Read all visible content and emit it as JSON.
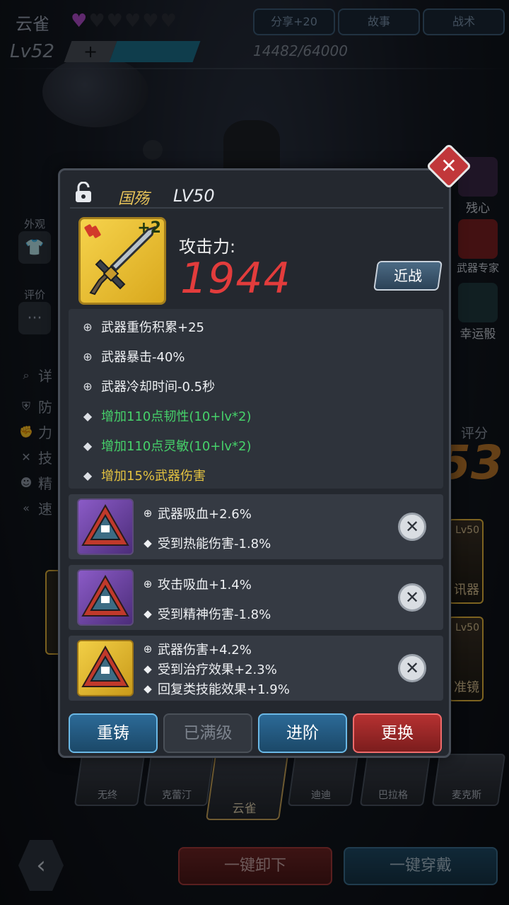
{
  "header": {
    "hero_name": "云雀",
    "hearts_total": 6,
    "hearts_filled": 1,
    "level": "Lv52",
    "exp_plus": "+",
    "exp_text": "14482/64000",
    "exp_progress": 0.23,
    "buttons": {
      "share": "分享+20",
      "story": "故事",
      "tactics": "战术"
    }
  },
  "side_left": {
    "appearance": "外观",
    "rating": "评价",
    "details": "详",
    "stats": [
      "防",
      "力",
      "技",
      "精",
      "速"
    ]
  },
  "side_right": {
    "residual": "残心",
    "weapon_expert": "武器专家",
    "lucky": "幸运骰",
    "score_label": "评分",
    "score_value": "53",
    "card1_level": "Lv50",
    "card1_name": "讯器",
    "card2_level": "Lv50",
    "card2_name": "准镜"
  },
  "heroes": [
    "无终",
    "克蕾汀",
    "云雀",
    "迪迪",
    "巴拉格",
    "麦克斯"
  ],
  "bottom": {
    "unequip_all": "一键卸下",
    "equip_all": "一键穿戴"
  },
  "dialog": {
    "weapon_name": "国殇",
    "weapon_level": "LV50",
    "weapon_plus": "+2",
    "attack_label": "攻击力:",
    "attack_value": "1944",
    "melee": "近战",
    "stats": [
      {
        "text": "武器重伤积累+25",
        "type": "white"
      },
      {
        "text": "武器暴击-40%",
        "type": "white"
      },
      {
        "text": "武器冷却时间-0.5秒",
        "type": "white"
      },
      {
        "text": "增加110点韧性(10+lv*2)",
        "type": "green"
      },
      {
        "text": "增加110点灵敏(10+lv*2)",
        "type": "green"
      },
      {
        "text": "增加15%武器伤害",
        "type": "yellow"
      }
    ],
    "gems": [
      {
        "lines": [
          "武器吸血+2.6%",
          "受到热能伤害-1.8%"
        ],
        "rarity": "purple"
      },
      {
        "lines": [
          "攻击吸血+1.4%",
          "受到精神伤害-1.8%"
        ],
        "rarity": "purple"
      },
      {
        "lines": [
          "武器伤害+4.2%",
          "受到治疗效果+2.3%",
          "回复类技能效果+1.9%"
        ],
        "rarity": "gold"
      }
    ],
    "actions": {
      "reforge": "重铸",
      "maxed": "已满级",
      "advance": "进阶",
      "replace": "更换"
    }
  },
  "colors": {
    "accent_blue": "#2c6a97",
    "accent_red": "#b63131",
    "attack_red": "#e23c3c",
    "green_stat": "#46d26a",
    "yellow_stat": "#e3c240",
    "heart_filled": "#b04cc9",
    "weapon_name": "#e8c35a"
  },
  "icons": {
    "close": "close-icon",
    "lock": "unlock-icon",
    "weapon": "sword-icon",
    "gem": "triangle-gem-icon",
    "remove": "x-circle-icon",
    "back": "chevron-left-icon"
  }
}
